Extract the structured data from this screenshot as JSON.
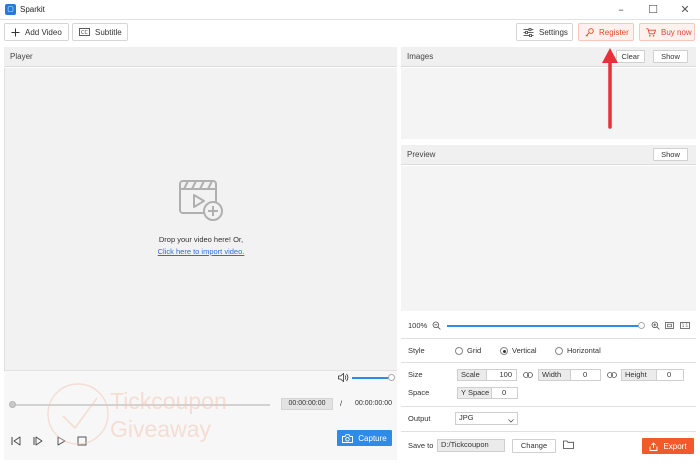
{
  "app": {
    "title": "Sparkit"
  },
  "toolbar": {
    "add_video": "Add Video",
    "subtitle": "Subtitle",
    "settings": "Settings",
    "register": "Register",
    "buy_now": "Buy now"
  },
  "player": {
    "title": "Player",
    "drop_text": "Drop your video here! Or,",
    "import_link": "Click here to import video.",
    "current_time": "00:00:00:00",
    "separator": "/",
    "total_time": "00:00:00:00",
    "capture": "Capture"
  },
  "images": {
    "title": "Images",
    "clear": "Clear",
    "show": "Show"
  },
  "preview": {
    "title": "Preview",
    "show": "Show",
    "zoom": "100%"
  },
  "style": {
    "label": "Style",
    "options": [
      "Grid",
      "Vertical",
      "Horizontal"
    ],
    "selected": "Vertical"
  },
  "size": {
    "label": "Size",
    "scale_label": "Scale",
    "scale_value": "100",
    "width_label": "Width",
    "width_value": "0",
    "height_label": "Height",
    "height_value": "0"
  },
  "space": {
    "label": "Space",
    "yspace_label": "Y Space",
    "yspace_value": "0"
  },
  "output": {
    "label": "Output",
    "format": "JPG"
  },
  "save": {
    "label": "Save to",
    "path": "D:/Tickcoupon",
    "change": "Change",
    "export": "Export"
  },
  "watermark": {
    "line1": "Tickcoupon",
    "line2": "Giveaway"
  },
  "colors": {
    "accent": "#2f8be8",
    "brand_red": "#f25a2a",
    "annotation_arrow": "#e8303a"
  }
}
